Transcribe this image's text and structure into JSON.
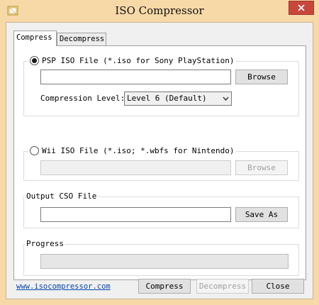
{
  "window": {
    "title": "ISO Compressor"
  },
  "tabs": [
    {
      "label": "Compress",
      "active": true
    },
    {
      "label": "Decompress",
      "active": false
    }
  ],
  "psp": {
    "radio_label": "PSP ISO File (*.iso for Sony PlayStation)",
    "selected": true,
    "file_value": "",
    "browse_label": "Browse",
    "compression_label": "Compression Level:",
    "compression_value": "Level 6 (Default)"
  },
  "wii": {
    "radio_label": "Wii ISO File (*.iso; *.wbfs for Nintendo)",
    "selected": false,
    "file_value": "",
    "browse_label": "Browse"
  },
  "output": {
    "group_label": "Output CSO File",
    "file_value": "",
    "save_label": "Save As"
  },
  "progress": {
    "group_label": "Progress",
    "value": 0
  },
  "footer": {
    "link": "www.isocompressor.com",
    "compress_label": "Compress",
    "decompress_label": "Decompress",
    "close_label": "Close"
  },
  "colors": {
    "title_bar": "#f7d9a8",
    "close_button": "#c7473d",
    "link": "#0645ad"
  }
}
